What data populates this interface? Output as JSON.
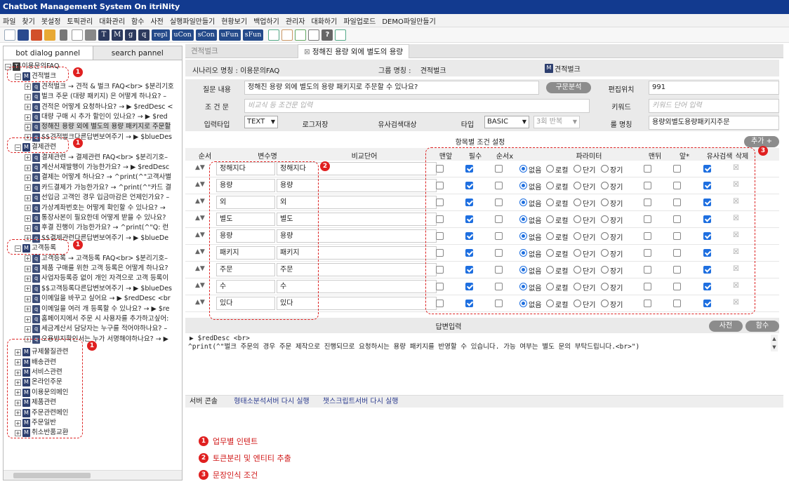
{
  "app_title": "Chatbot Management System On itriNity",
  "menu": [
    "파일",
    "찾기",
    "봇설정",
    "토픽관리",
    "대화관리",
    "함수",
    "사전",
    "실행파일만들기",
    "현황보기",
    "백업하기",
    "관리자",
    "대화하기",
    "파일업로드",
    "DEMO파일만들기"
  ],
  "toolbar": {
    "letters": [
      "T",
      "M",
      "g",
      "q"
    ],
    "words": [
      "repl",
      "uCon",
      "sCon",
      "uFun",
      "sFun"
    ]
  },
  "left_tabs": {
    "dialog": "bot dialog pannel",
    "search": "search pannel"
  },
  "tree": {
    "root": "이용문의FAQ",
    "g1": {
      "label": "견적벌크",
      "items": [
        "견적벌크 → 견적 & 벌크 FAQ<br> $분리기호",
        "벌크 주문 (대량 패키지) 은 어떻게 하나요? –",
        "견적은 어떻게 요청하나요? → ▶ $redDesc <",
        "대량 구매 시 추가 할인이 있나요? → ▶ $red",
        "정해진 용량 외에 별도의 용량 패키지로 주문할",
        "$$견적벌크다른답변보여주기 → ▶ $blueDes"
      ]
    },
    "g2": {
      "label": "결제관련",
      "items": [
        "결제관련 → 결제관련 FAQ<br> $분리기호–",
        "계산서재발행이 가능한가요? → ▶ $redDesc",
        "결제는 어떻게 하나요? → ^print(^\"고객사별",
        "카드결제가 가능한가요? → ^print(^\"카드 결",
        "선입금 고객인 경우 입금마감은 언제인가요? –",
        "가상계좌번호는 어떻게 확인할 수 있나요? →",
        "통장사본이 필요한데 어떻게 받을 수 있나요?",
        "후결 진행이 가능한가요? → ^print(^\"Q: 런",
        "$$결제관련다른답변보여주기 → ▶ $blueDe"
      ]
    },
    "g3": {
      "label": "고객등록",
      "items": [
        "고객등록 → 고객등록 FAQ<br> $분리기호–",
        "제품 구매를 위한 고객 등록은 어떻게 하나요?",
        "사업자등록증 없이 개인 자격으로 고객 등록이",
        "$$고객등록다른답변보여주기 → ▶ $blueDes",
        "이메일을 바꾸고 싶어요 → ▶ $redDesc <br",
        "이메일을 여러 개 등록할 수 있나요? → ▶ $re",
        "홈페이지에서 주문 시 사용자를 추가하고싶어:",
        "세금계산서 담당자는 누구를 적어야하나요? –",
        "오용방지확인서는 누가 서명해야하나요? → ▶"
      ]
    },
    "others": [
      "규제물질관련",
      "배송관련",
      "서비스관련",
      "온라인주문",
      "이용문의메인",
      "제품관련",
      "주문관련메인",
      "주문일반",
      "취소반품교환"
    ]
  },
  "right_tabs": {
    "tab1": "견적벌크",
    "tab2": "정해진 용량 외에 별도의 용량"
  },
  "form": {
    "scenario_label": "시나리오 명칭 :",
    "scenario_value": "이용문의FAQ",
    "group_label": "그룹 명칭 :",
    "group_value": "견적벌크",
    "badge_value": "견적벌크",
    "question_label": "질문 내용",
    "question_value": "정해진 용량 외에 별도의 용량 패키지로 주문할 수 있나요?",
    "analyze_btn": "구문분석",
    "editpos_label": "편집위치",
    "editpos_value": "991",
    "condition_label": "조 건 문",
    "condition_ph": "비교식 등 조건문 입력",
    "keyword_label": "키워드",
    "keyword_ph": "키워드 단어 입력",
    "inputtype_label": "입력타입",
    "inputtype_value": "TEXT",
    "log_label": "로그저장",
    "similar_label": "유사검색대상",
    "type_label": "타입",
    "type_value": "BASIC",
    "repeat_value": "3회 반복",
    "rulename_label": "룰 명칭",
    "rulename_value": "용량외별도용량패키지주문"
  },
  "conditions": {
    "title": "항목별 조건 설정",
    "add_btn": "추가 +",
    "headers": [
      "순서",
      "변수명",
      "비교단어",
      "맨앞",
      "필수",
      "순서x",
      "파라미터",
      "맨뒤",
      "앞*",
      "유사검색",
      "삭제"
    ],
    "radio_labels": [
      "없음",
      "로컬",
      "단기",
      "장기"
    ],
    "rows": [
      {
        "var": "정해지다",
        "word": "정해지다",
        "front": false,
        "req": true,
        "ordx": false,
        "param": "없음",
        "back": false,
        "pre": false,
        "sim": true
      },
      {
        "var": "용량",
        "word": "용량",
        "front": false,
        "req": true,
        "ordx": false,
        "param": "없음",
        "back": false,
        "pre": false,
        "sim": true
      },
      {
        "var": "외",
        "word": "외",
        "front": false,
        "req": true,
        "ordx": false,
        "param": "없음",
        "back": false,
        "pre": false,
        "sim": true
      },
      {
        "var": "별도",
        "word": "별도",
        "front": false,
        "req": true,
        "ordx": false,
        "param": "없음",
        "back": false,
        "pre": false,
        "sim": true
      },
      {
        "var": "용량",
        "word": "용량",
        "front": false,
        "req": true,
        "ordx": false,
        "param": "없음",
        "back": false,
        "pre": false,
        "sim": true
      },
      {
        "var": "패키지",
        "word": "패키지",
        "front": false,
        "req": true,
        "ordx": false,
        "param": "없음",
        "back": false,
        "pre": false,
        "sim": true
      },
      {
        "var": "주문",
        "word": "주문",
        "front": false,
        "req": true,
        "ordx": false,
        "param": "없음",
        "back": false,
        "pre": false,
        "sim": true
      },
      {
        "var": "수",
        "word": "수",
        "front": false,
        "req": true,
        "ordx": false,
        "param": "없음",
        "back": false,
        "pre": false,
        "sim": true
      },
      {
        "var": "있다",
        "word": "있다",
        "front": false,
        "req": true,
        "ordx": false,
        "param": "없음",
        "back": false,
        "pre": false,
        "sim": true
      }
    ]
  },
  "answer": {
    "title": "답변입력",
    "dict_btn": "사전",
    "func_btn": "함수",
    "line1": "▶ $redDesc <br>",
    "line2": "^print(^\"벌크 주문의 경우 주문 제작으로 진행되므로 요청하시는 용량 패키지를 반영할 수 있습니다. 가능 여부는 별도 문의 부탁드립니다.<br>\")"
  },
  "console": {
    "label": "서버 콘솔",
    "link1": "형태소분석서버 다시 실행",
    "link2": "챗스크립트서버 다시 실행"
  },
  "legend": [
    {
      "num": "1",
      "text": "업무별 인텐트"
    },
    {
      "num": "2",
      "text": "토큰분리 및 엔티티 추출"
    },
    {
      "num": "3",
      "text": "문장인식 조건"
    }
  ],
  "colors": {
    "title_bar": "#123a8f",
    "accent": "#1e6fe0",
    "callout": "#e02020"
  }
}
